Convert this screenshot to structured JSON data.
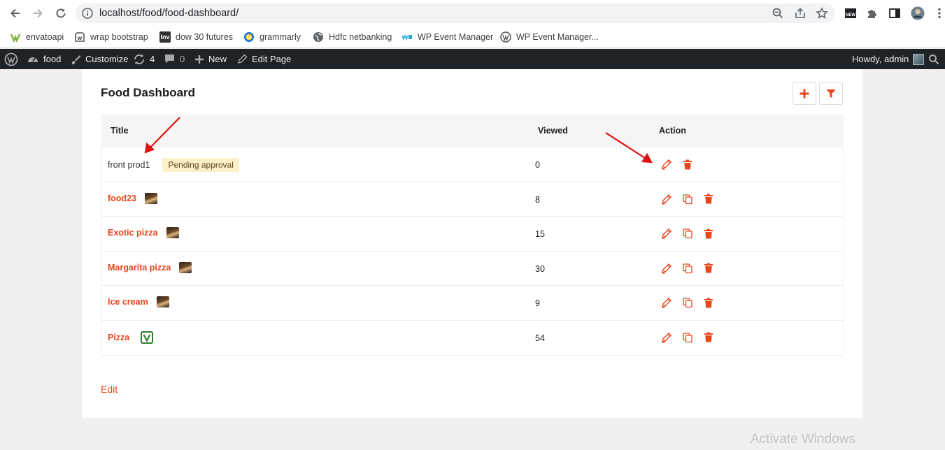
{
  "browser": {
    "url": "localhost/food/food-dashboard/",
    "bookmarks": [
      {
        "label": "envatoapi",
        "icon": "envato-icon",
        "color": "#82b541"
      },
      {
        "label": "wrap bootstrap",
        "icon": "wrapbootstrap-icon",
        "color": "#333333"
      },
      {
        "label": "dow 30 futures",
        "icon": "investing-icon",
        "color": "#333333"
      },
      {
        "label": "grammarly",
        "icon": "grammarly-icon",
        "color": "#15c39a"
      },
      {
        "label": "Hdfc netbanking",
        "icon": "globe-icon",
        "color": "#555555"
      },
      {
        "label": "WP Event Manager",
        "icon": "wpem-icon",
        "color": "#27a8e0"
      },
      {
        "label": "WP Event Manager...",
        "icon": "wordpress-icon",
        "color": "#555555"
      }
    ]
  },
  "adminbar": {
    "site_name": "food",
    "customize": "Customize",
    "updates_count": "4",
    "comments_count": "0",
    "new_label": "New",
    "edit_page": "Edit Page",
    "howdy": "Howdy, admin"
  },
  "dashboard": {
    "title": "Food Dashboard",
    "columns": {
      "title": "Title",
      "viewed": "Viewed",
      "action": "Action"
    },
    "rows": [
      {
        "title": "front prod1",
        "is_link": false,
        "badge": "Pending approval",
        "thumb": "none",
        "viewed": "0",
        "actions": [
          "edit",
          "delete"
        ]
      },
      {
        "title": "food23",
        "is_link": true,
        "badge": "",
        "thumb": "food",
        "viewed": "8",
        "actions": [
          "edit",
          "duplicate",
          "delete"
        ]
      },
      {
        "title": "Exotic pizza",
        "is_link": true,
        "badge": "",
        "thumb": "food",
        "viewed": "15",
        "actions": [
          "edit",
          "duplicate",
          "delete"
        ]
      },
      {
        "title": "Margarita pizza",
        "is_link": true,
        "badge": "",
        "thumb": "food",
        "viewed": "30",
        "actions": [
          "edit",
          "duplicate",
          "delete"
        ]
      },
      {
        "title": "Ice cream",
        "is_link": true,
        "badge": "",
        "thumb": "food",
        "viewed": "9",
        "actions": [
          "edit",
          "duplicate",
          "delete"
        ]
      },
      {
        "title": "Pizza",
        "is_link": true,
        "badge": "",
        "thumb": "veg",
        "viewed": "54",
        "actions": [
          "edit",
          "duplicate",
          "delete"
        ]
      }
    ],
    "edit_link": "Edit"
  },
  "watermark": "Activate Windows",
  "colors": {
    "accent": "#e8461b",
    "adminbar": "#1d2327",
    "annotation": "#e01010"
  }
}
